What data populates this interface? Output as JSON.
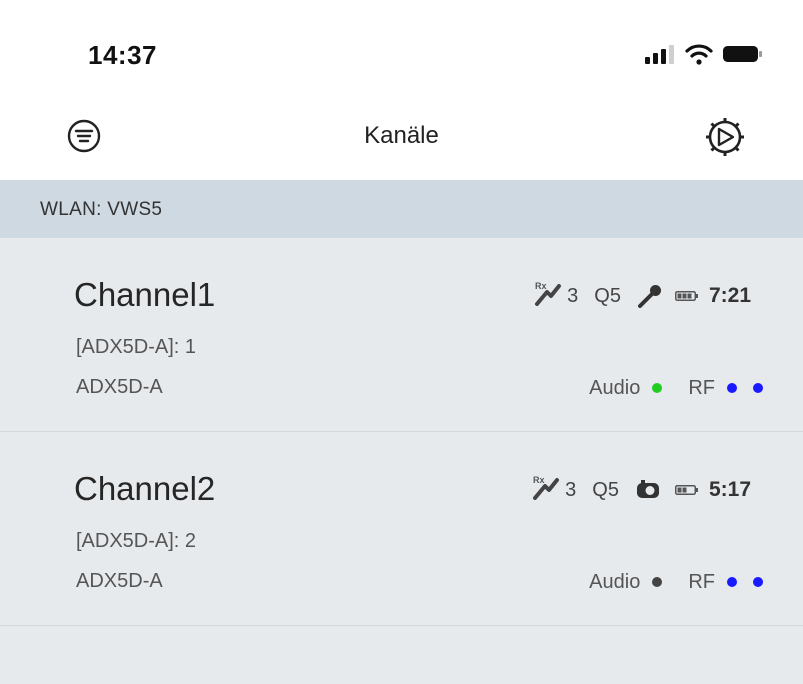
{
  "status_bar": {
    "time": "14:37",
    "icons": [
      "cellular-signal-icon",
      "wifi-icon",
      "battery-icon"
    ]
  },
  "nav": {
    "title": "Kanäle",
    "left_icon": "filter-menu-icon",
    "right_icon": "device-wheel-icon"
  },
  "section": {
    "header": "WLAN: VWS5"
  },
  "channels": [
    {
      "name": "Channel1",
      "sub": "[ADX5D-A]: 1",
      "model": "ADX5D-A",
      "rx_label": "Rx",
      "rx_count": "3",
      "quality": "Q5",
      "transmitter_icon": "handheld-mic-icon",
      "battery_icon": "battery-icon",
      "battery_time": "7:21",
      "audio_label": "Audio",
      "audio_status_color": "#22cc22",
      "rf_label": "RF",
      "rf_dot_colors": [
        "#1a1aff",
        "#1a1aff"
      ]
    },
    {
      "name": "Channel2",
      "sub": "[ADX5D-A]: 2",
      "model": "ADX5D-A",
      "rx_label": "Rx",
      "rx_count": "3",
      "quality": "Q5",
      "transmitter_icon": "bodypack-icon",
      "battery_icon": "battery-icon",
      "battery_time": "5:17",
      "audio_label": "Audio",
      "audio_status_color": "#444444",
      "rf_label": "RF",
      "rf_dot_colors": [
        "#1a1aff",
        "#1a1aff"
      ]
    }
  ],
  "colors": {
    "section_header_bg": "#cfd9e1",
    "list_bg": "#e7eaed",
    "rf_active": "#1a1aff",
    "audio_active": "#22cc22",
    "audio_inactive": "#444444"
  }
}
